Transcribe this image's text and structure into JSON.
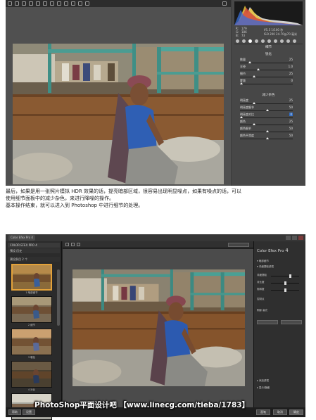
{
  "camera_raw": {
    "readout": {
      "r_label": "R:",
      "r_value": "179",
      "g_label": "G:",
      "g_value": "186",
      "b_label": "B:",
      "b_value": "73",
      "line1": "f/5.5   1/100 秒",
      "line2": "ISO 200   24-70@70 毫米"
    },
    "detail_tab_title": "细节",
    "sharpening": {
      "title": "锐化",
      "sliders": [
        {
          "label": "数量",
          "value": "25",
          "level": 0.17
        },
        {
          "label": "半径",
          "value": "1.0",
          "level": 0.33
        },
        {
          "label": "细节",
          "value": "25",
          "level": 0.25
        },
        {
          "label": "蒙版",
          "value": "0",
          "level": 0.0
        }
      ]
    },
    "noise_reduction": {
      "title": "减少杂色",
      "sliders": [
        {
          "label": "明亮度",
          "value": "25",
          "level": 0.25,
          "highlight": false
        },
        {
          "label": "明亮度细节",
          "value": "50",
          "level": 0.5,
          "highlight": false
        },
        {
          "label": "明亮度对比",
          "value": "0",
          "level": 0.0,
          "highlight": true
        },
        {
          "label": "颜色",
          "value": "25",
          "level": 0.25,
          "highlight": false
        },
        {
          "label": "颜色细节",
          "value": "50",
          "level": 0.5,
          "highlight": false
        },
        {
          "label": "颜色平滑度",
          "value": "50",
          "level": 0.5,
          "highlight": false
        }
      ]
    }
  },
  "paragraph": {
    "line1": "最后，如果是用一张照片模拟 HDR 效果的话，提亮暗部区域，很容易出现明显噪点，如果有噪点的话，可以",
    "line2": "使用细节面板中的减少杂色，来进行降噪的操作。",
    "line3": "基本操作结束，就可以进入到 Photoshop 中进行细节的处理。"
  },
  "color_efex": {
    "app_title": "Color Efex Pro 4",
    "left_header": "COLOR EFEX PRO 4",
    "left_tabs": "预设    历史",
    "preset_group": "预设条目 2 个",
    "thumbnails": [
      {
        "label": "1 暗部细节",
        "selected": true
      },
      {
        "label": "2 细节",
        "selected": false
      },
      {
        "label": "3 暖色",
        "selected": false
      },
      {
        "label": "4 对比",
        "selected": false
      },
      {
        "label": "5 模拟",
        "selected": false
      }
    ],
    "right_panel": {
      "filter_name": "Color Efex Pro",
      "filter_version": "4",
      "row1": "▾ 暗部细节",
      "row2": "▾ 详细提取滤镜",
      "slider_labels": [
        "详细提取",
        "对比度",
        "饱和度"
      ],
      "slider_levels": [
        0.7,
        0.5,
        0.5
      ],
      "misc1": "控制点",
      "misc2": "阴影     高光",
      "misc3": "▸ 添加滤镜",
      "misc4": "▸ 显示/隐藏"
    },
    "bottom_buttons": {
      "help": "帮助",
      "settings": "设置",
      "brush": "画笔",
      "cancel": "取消",
      "ok": "确定"
    },
    "watermark": "PhotoShop平面设计吧 【www.linecg.com/tieba/1783】"
  }
}
